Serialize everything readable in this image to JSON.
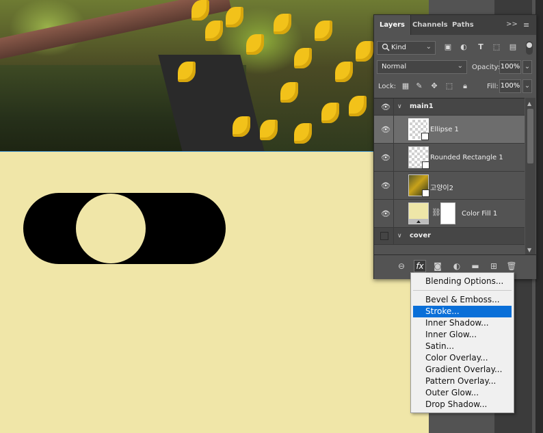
{
  "panel": {
    "tabs": [
      "Layers",
      "Channels",
      "Paths"
    ],
    "more_glyph": ">>",
    "menu_glyph": "≡",
    "filter": {
      "kind_label": "Kind",
      "icons": [
        "image-filter-icon",
        "adjustment-filter-icon",
        "type-filter-icon",
        "shape-filter-icon",
        "smart-object-filter-icon"
      ]
    },
    "blend_mode": "Normal",
    "opacity_label": "Opacity:",
    "opacity_value": "100%",
    "lock_label": "Lock:",
    "fill_label": "Fill:",
    "fill_value": "100%"
  },
  "layers": [
    {
      "type": "group",
      "name": "main1",
      "visible": true
    },
    {
      "type": "layer",
      "name": "Ellipse 1",
      "selected": true
    },
    {
      "type": "layer",
      "name": "Rounded Rectangle 1"
    },
    {
      "type": "layer",
      "name": "고양이2"
    },
    {
      "type": "layer",
      "name": "Color Fill 1"
    },
    {
      "type": "group",
      "name": "cover",
      "visible": false
    }
  ],
  "bottom_icons": [
    "link-layers-icon",
    "fx-icon",
    "add-mask-icon",
    "adjustment-layer-icon",
    "new-group-icon",
    "new-layer-icon",
    "delete-layer-icon"
  ],
  "fx_label": "fx",
  "menu": {
    "items": [
      "Blending Options...",
      "Bevel & Emboss...",
      "Stroke...",
      "Inner Shadow...",
      "Inner Glow...",
      "Satin...",
      "Color Overlay...",
      "Gradient Overlay...",
      "Pattern Overlay...",
      "Outer Glow...",
      "Drop Shadow..."
    ],
    "highlighted": "Stroke..."
  },
  "colors": {
    "canvas": "#f0e6a8",
    "highlight": "#0a6fd8",
    "panel": "#535353"
  }
}
